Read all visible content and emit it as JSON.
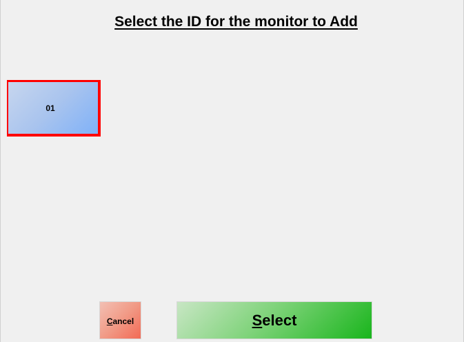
{
  "dialog": {
    "title": "Select the ID for the monitor to Add"
  },
  "monitor_ids": [
    {
      "label": "01",
      "selected": true
    }
  ],
  "actions": {
    "cancel": {
      "mnemonic": "C",
      "rest": "ancel"
    },
    "select": {
      "mnemonic": "S",
      "rest": "elect"
    }
  },
  "colors": {
    "selection_border": "#ff0000",
    "id_button": "#a9c4ee",
    "cancel_button": "#f19a86",
    "select_button": "#19b51c",
    "background": "#f0f0f0"
  }
}
